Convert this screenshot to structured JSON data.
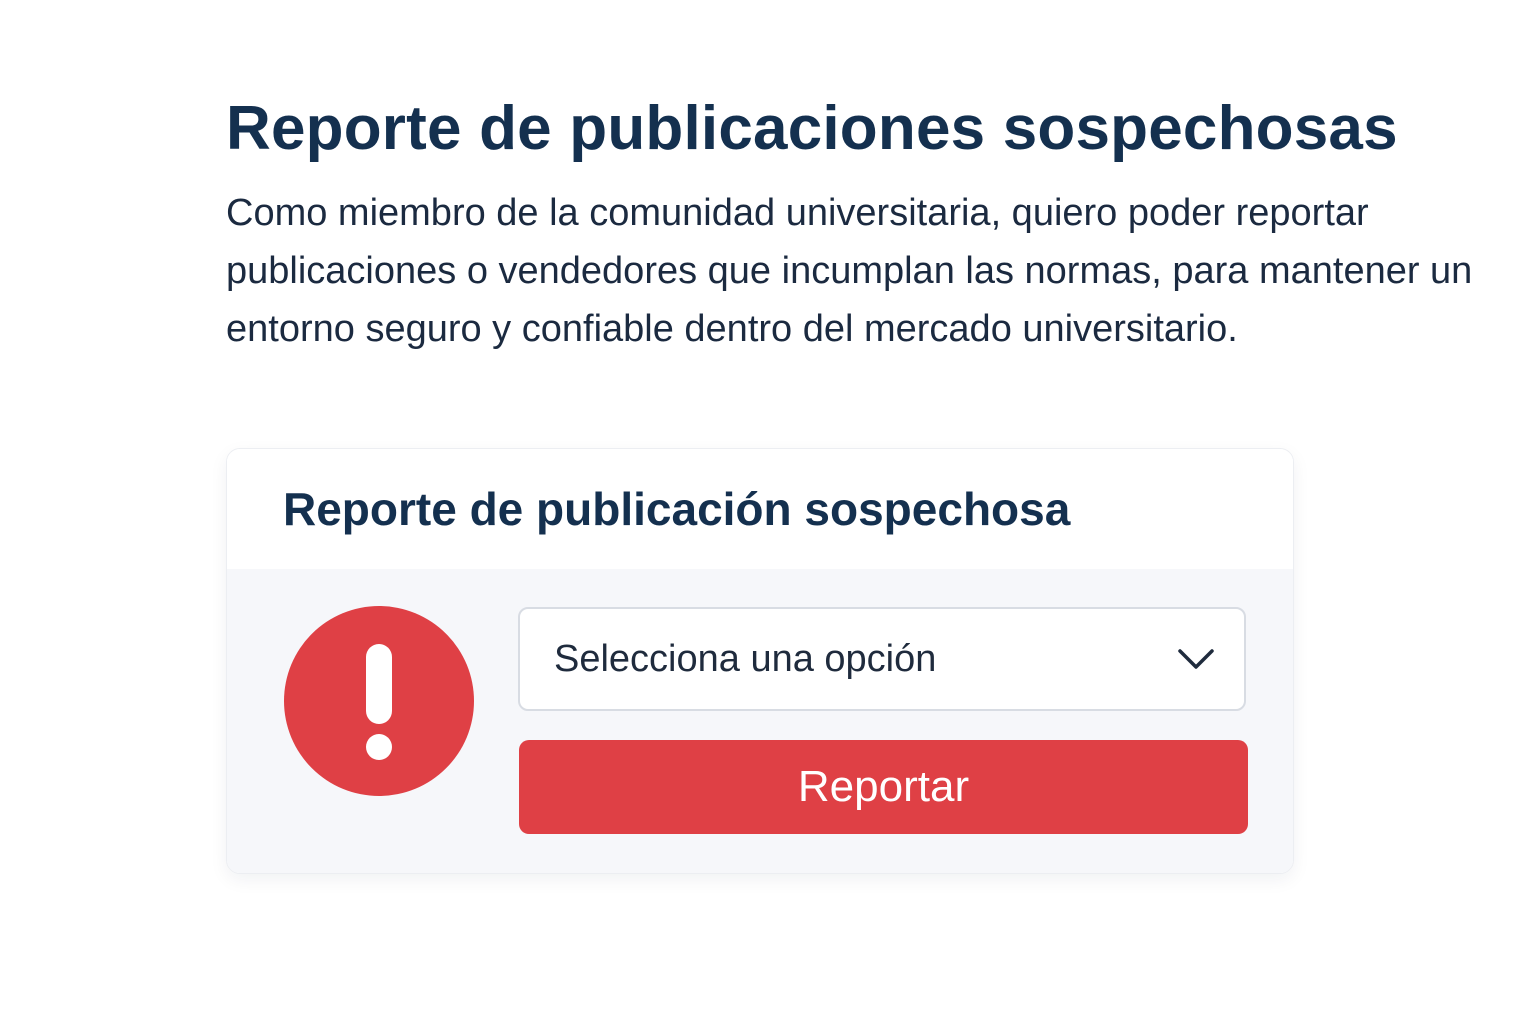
{
  "page": {
    "title": "Reporte de publicaciones sospechosas",
    "description": "Como miembro de la comunidad universitaria, quiero poder reportar publicaciones o vendedores que incumplan las normas, para mantener un entorno seguro y confiable dentro del mercado universitario."
  },
  "card": {
    "title": "Reporte de publicación sospechosa",
    "alert_icon": "exclamation-alert-icon",
    "select": {
      "value": "Selecciona una opción",
      "icon": "chevron-down-icon"
    },
    "report_button_label": "Reportar"
  },
  "colors": {
    "heading": "#14304f",
    "accent_red": "#df4045",
    "card_body_bg": "#f6f7fa"
  }
}
